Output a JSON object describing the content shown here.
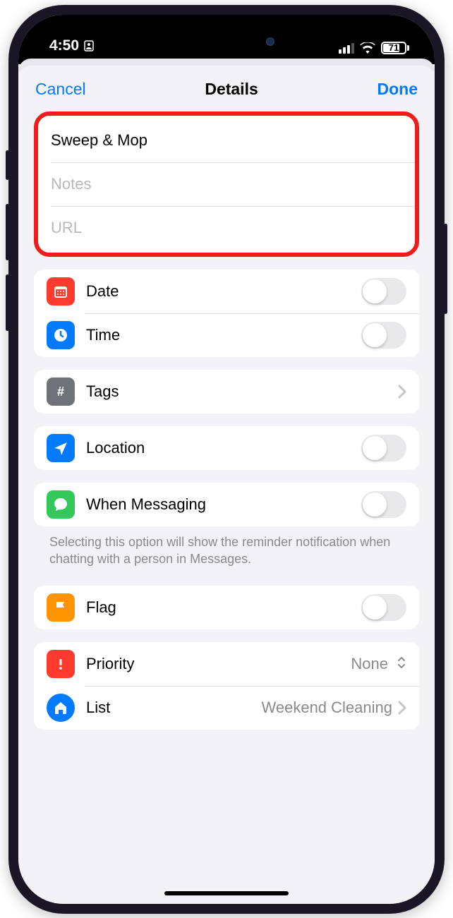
{
  "status": {
    "time": "4:50",
    "battery": "71"
  },
  "nav": {
    "cancel": "Cancel",
    "title": "Details",
    "done": "Done"
  },
  "fields": {
    "title_value": "Sweep & Mop",
    "notes_placeholder": "Notes",
    "url_placeholder": "URL"
  },
  "rows": {
    "date": "Date",
    "time": "Time",
    "tags": "Tags",
    "location": "Location",
    "when_messaging": "When Messaging",
    "flag": "Flag",
    "priority": "Priority",
    "priority_value": "None",
    "list": "List",
    "list_value": "Weekend Cleaning"
  },
  "hint": {
    "when_messaging": "Selecting this option will show the reminder notification when chatting with a person in Messages."
  }
}
